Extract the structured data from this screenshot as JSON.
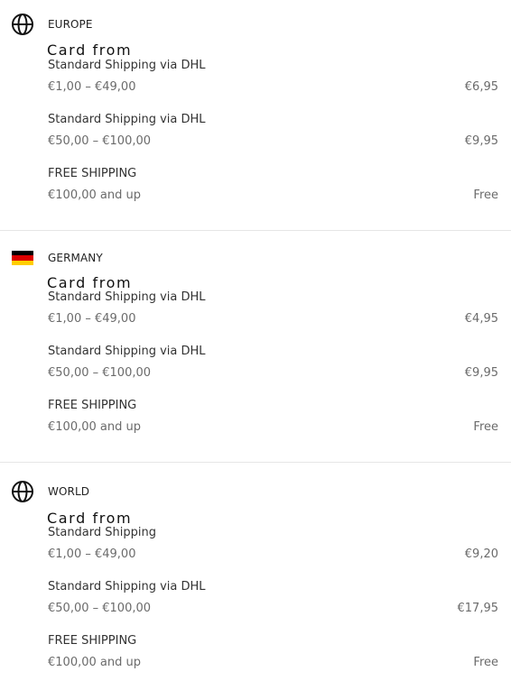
{
  "zones": [
    {
      "region": "EUROPE",
      "icon": "globe-icon",
      "card_from": "Card from",
      "rates": [
        {
          "method": "Standard Shipping via DHL",
          "range": "€1,00 – €49,00",
          "price": "€6,95"
        },
        {
          "method": "Standard Shipping via DHL",
          "range": "€50,00 – €100,00",
          "price": "€9,95"
        },
        {
          "method": "FREE SHIPPING",
          "range": "€100,00 and up",
          "price": "Free"
        }
      ]
    },
    {
      "region": "GERMANY",
      "icon": "germany-flag-icon",
      "flag_colors": [
        "#000000",
        "#dd0000",
        "#ffce00"
      ],
      "card_from": "Card from",
      "rates": [
        {
          "method": "Standard Shipping via DHL",
          "range": "€1,00 – €49,00",
          "price": "€4,95"
        },
        {
          "method": "Standard Shipping via DHL",
          "range": "€50,00 – €100,00",
          "price": "€9,95"
        },
        {
          "method": "FREE SHIPPING",
          "range": "€100,00 and up",
          "price": "Free"
        }
      ]
    },
    {
      "region": "WORLD",
      "icon": "globe-icon",
      "card_from": "Card from",
      "rates": [
        {
          "method": "Standard Shipping",
          "range": "€1,00 – €49,00",
          "price": "€9,20"
        },
        {
          "method": "Standard Shipping via DHL",
          "range": "€50,00 – €100,00",
          "price": "€17,95"
        },
        {
          "method": "FREE SHIPPING",
          "range": "€100,00 and up",
          "price": "Free"
        }
      ]
    }
  ]
}
